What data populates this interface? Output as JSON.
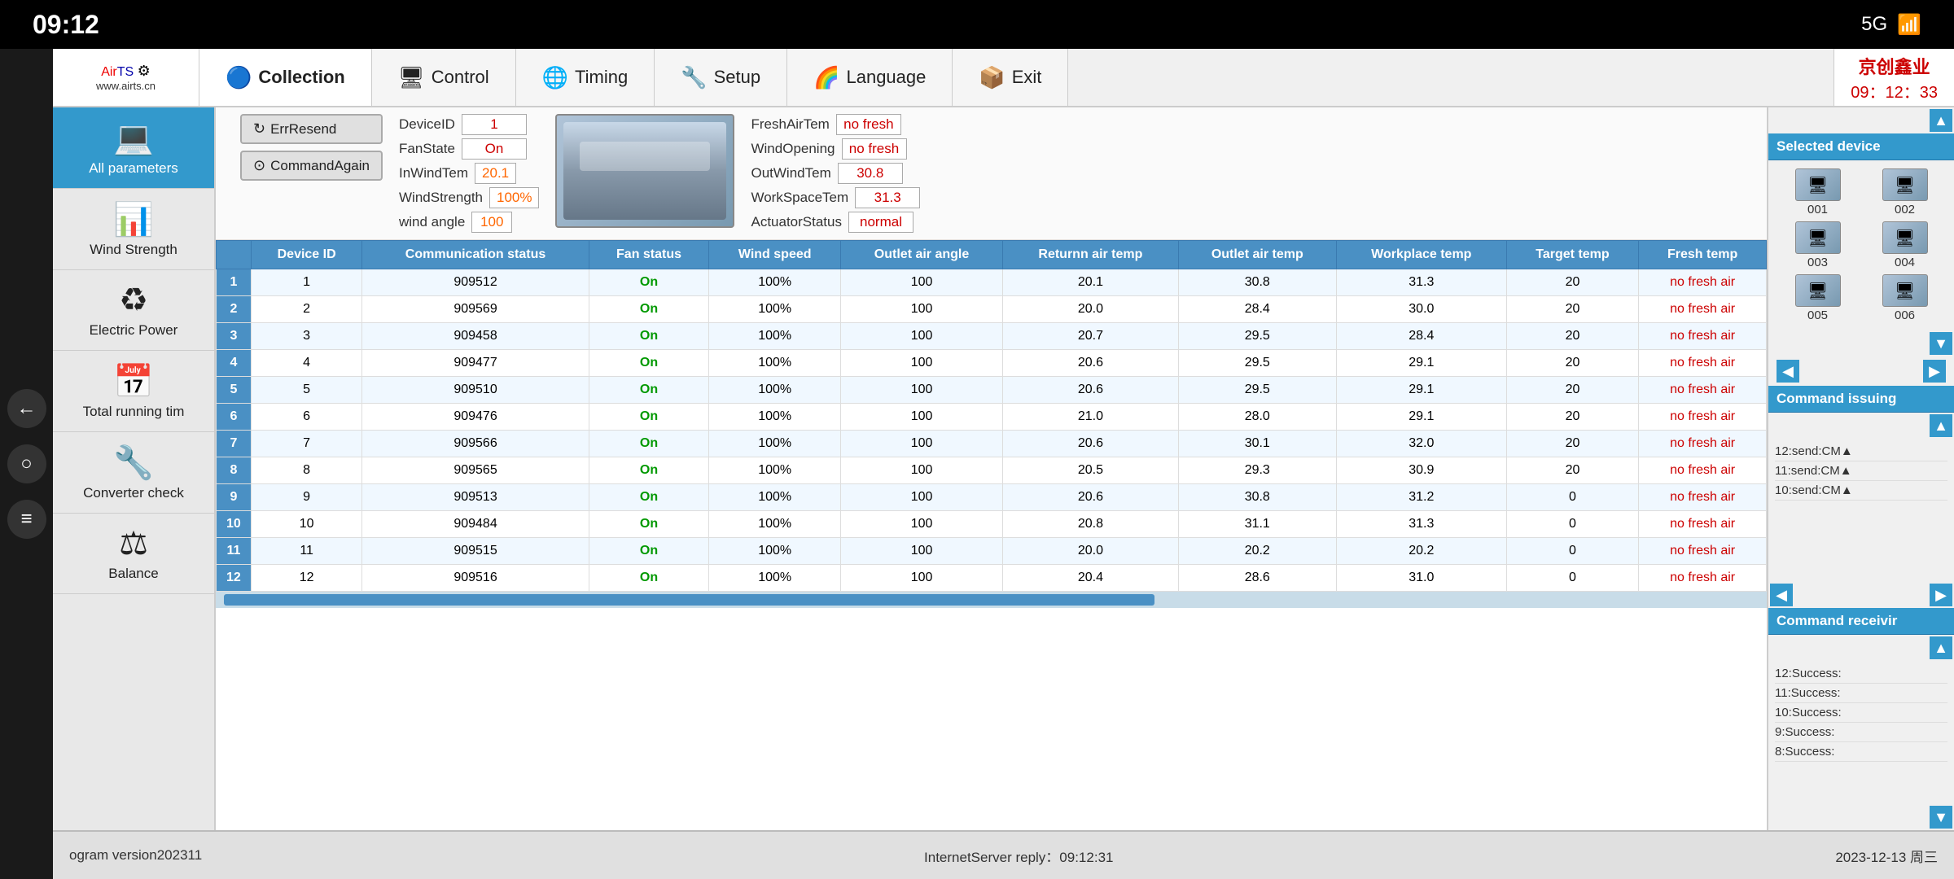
{
  "statusBar": {
    "time": "09:12",
    "signal": "5G",
    "wifiIcon": "📶"
  },
  "nav": {
    "logo": "AirTS",
    "logoSub": "www.airts.cn",
    "items": [
      {
        "id": "collection",
        "label": "Collection",
        "icon": "🔵",
        "active": true
      },
      {
        "id": "control",
        "label": "Control",
        "icon": "🖥"
      },
      {
        "id": "timing",
        "label": "Timing",
        "icon": "🌐"
      },
      {
        "id": "setup",
        "label": "Setup",
        "icon": "🔧"
      },
      {
        "id": "language",
        "label": "Language",
        "icon": "🟡"
      },
      {
        "id": "exit",
        "label": "Exit",
        "icon": "📦"
      }
    ],
    "brandName": "京创鑫业",
    "brandTime": "09：12：33"
  },
  "sidebar": {
    "items": [
      {
        "id": "all-params",
        "label": "All parameters",
        "icon": "💻",
        "active": true
      },
      {
        "id": "wind-strength",
        "label": "Wind Strength",
        "icon": "📊"
      },
      {
        "id": "electric-power",
        "label": "Electric Power",
        "icon": "♻"
      },
      {
        "id": "total-running",
        "label": "Total running tim",
        "icon": "📅"
      },
      {
        "id": "converter-check",
        "label": "Converter check",
        "icon": "🔧"
      },
      {
        "id": "balance",
        "label": "Balance",
        "icon": "⚖"
      }
    ]
  },
  "deviceInfo": {
    "deviceID": {
      "label": "DeviceID",
      "value": "1",
      "color": "red"
    },
    "fanState": {
      "label": "FanState",
      "value": "On",
      "color": "red"
    },
    "inWindTem": {
      "label": "InWindTem",
      "value": "20.1",
      "color": "orange"
    },
    "windStrength": {
      "label": "WindStrength",
      "value": "100%",
      "color": "orange"
    },
    "windAngle": {
      "label": "wind angle",
      "value": "100",
      "color": "orange"
    },
    "freshAirTem": {
      "label": "FreshAirTem",
      "value": "no fresh",
      "color": "red"
    },
    "windOpening": {
      "label": "WindOpening",
      "value": "no fresh",
      "color": "red"
    },
    "outWindTem": {
      "label": "OutWindTem",
      "value": "30.8",
      "color": "red"
    },
    "workSpaceTem": {
      "label": "WorkSpaceTem",
      "value": "31.3",
      "color": "red"
    },
    "actuatorStatus": {
      "label": "ActuatorStatus",
      "value": "normal",
      "color": "red"
    }
  },
  "buttons": {
    "errResend": "ErrResend",
    "commandAgain": "CommandAgain"
  },
  "table": {
    "columns": [
      "Device ID",
      "Communication status",
      "Fan status",
      "Wind speed",
      "Outlet air angle",
      "Returnn air temp",
      "Outlet air temp",
      "Workplace temp",
      "Target temp",
      "Fresh temp"
    ],
    "rows": [
      {
        "rowNum": 1,
        "deviceId": 1,
        "commStatus": 909512,
        "fanStatus": "On",
        "windSpeed": "100%",
        "airAngle": 100,
        "returnTemp": "20.1",
        "outletTemp": "30.8",
        "workplaceTemp": "31.3",
        "targetTemp": 20,
        "freshTemp": "no fresh air"
      },
      {
        "rowNum": 2,
        "deviceId": 2,
        "commStatus": 909569,
        "fanStatus": "On",
        "windSpeed": "100%",
        "airAngle": 100,
        "returnTemp": "20.0",
        "outletTemp": "28.4",
        "workplaceTemp": "30.0",
        "targetTemp": 20,
        "freshTemp": "no fresh air"
      },
      {
        "rowNum": 3,
        "deviceId": 3,
        "commStatus": 909458,
        "fanStatus": "On",
        "windSpeed": "100%",
        "airAngle": 100,
        "returnTemp": "20.7",
        "outletTemp": "29.5",
        "workplaceTemp": "28.4",
        "targetTemp": 20,
        "freshTemp": "no fresh air"
      },
      {
        "rowNum": 4,
        "deviceId": 4,
        "commStatus": 909477,
        "fanStatus": "On",
        "windSpeed": "100%",
        "airAngle": 100,
        "returnTemp": "20.6",
        "outletTemp": "29.5",
        "workplaceTemp": "29.1",
        "targetTemp": 20,
        "freshTemp": "no fresh air"
      },
      {
        "rowNum": 5,
        "deviceId": 5,
        "commStatus": 909510,
        "fanStatus": "On",
        "windSpeed": "100%",
        "airAngle": 100,
        "returnTemp": "20.6",
        "outletTemp": "29.5",
        "workplaceTemp": "29.1",
        "targetTemp": 20,
        "freshTemp": "no fresh air"
      },
      {
        "rowNum": 6,
        "deviceId": 6,
        "commStatus": 909476,
        "fanStatus": "On",
        "windSpeed": "100%",
        "airAngle": 100,
        "returnTemp": "21.0",
        "outletTemp": "28.0",
        "workplaceTemp": "29.1",
        "targetTemp": 20,
        "freshTemp": "no fresh air"
      },
      {
        "rowNum": 7,
        "deviceId": 7,
        "commStatus": 909566,
        "fanStatus": "On",
        "windSpeed": "100%",
        "airAngle": 100,
        "returnTemp": "20.6",
        "outletTemp": "30.1",
        "workplaceTemp": "32.0",
        "targetTemp": 20,
        "freshTemp": "no fresh air"
      },
      {
        "rowNum": 8,
        "deviceId": 8,
        "commStatus": 909565,
        "fanStatus": "On",
        "windSpeed": "100%",
        "airAngle": 100,
        "returnTemp": "20.5",
        "outletTemp": "29.3",
        "workplaceTemp": "30.9",
        "targetTemp": 20,
        "freshTemp": "no fresh air"
      },
      {
        "rowNum": 9,
        "deviceId": 9,
        "commStatus": 909513,
        "fanStatus": "On",
        "windSpeed": "100%",
        "airAngle": 100,
        "returnTemp": "20.6",
        "outletTemp": "30.8",
        "workplaceTemp": "31.2",
        "targetTemp": 0,
        "freshTemp": "no fresh air"
      },
      {
        "rowNum": 10,
        "deviceId": 10,
        "commStatus": 909484,
        "fanStatus": "On",
        "windSpeed": "100%",
        "airAngle": 100,
        "returnTemp": "20.8",
        "outletTemp": "31.1",
        "workplaceTemp": "31.3",
        "targetTemp": 0,
        "freshTemp": "no fresh air"
      },
      {
        "rowNum": 11,
        "deviceId": 11,
        "commStatus": 909515,
        "fanStatus": "On",
        "windSpeed": "100%",
        "airAngle": 100,
        "returnTemp": "20.0",
        "outletTemp": "20.2",
        "workplaceTemp": "20.2",
        "targetTemp": 0,
        "freshTemp": "no fresh air"
      },
      {
        "rowNum": 12,
        "deviceId": 12,
        "commStatus": 909516,
        "fanStatus": "On",
        "windSpeed": "100%",
        "airAngle": 100,
        "returnTemp": "20.4",
        "outletTemp": "28.6",
        "workplaceTemp": "31.0",
        "targetTemp": 0,
        "freshTemp": "no fresh air"
      }
    ]
  },
  "rightPanel": {
    "selectedDeviceLabel": "Selected device",
    "devices": [
      {
        "id": "001",
        "label": "001"
      },
      {
        "id": "002",
        "label": "002"
      },
      {
        "id": "003",
        "label": "003"
      },
      {
        "id": "004",
        "label": "004"
      },
      {
        "id": "005",
        "label": "005"
      },
      {
        "id": "006",
        "label": "006"
      }
    ],
    "cmdIssuingLabel": "Command issuing",
    "cmdIssuing": [
      "12:send:CM▲",
      "11:send:CM▲",
      "10:send:CM▲"
    ],
    "cmdReceivingLabel": "Command receivir",
    "cmdReceiving": [
      "12:Success:",
      "11:Success:",
      "10:Success:",
      "9:Success:",
      "8:Success:"
    ]
  },
  "bottomBar": {
    "version": "ogram version202311",
    "serverReply": "InternetServer reply：09:12:31",
    "date": "2023-12-13 周三"
  }
}
